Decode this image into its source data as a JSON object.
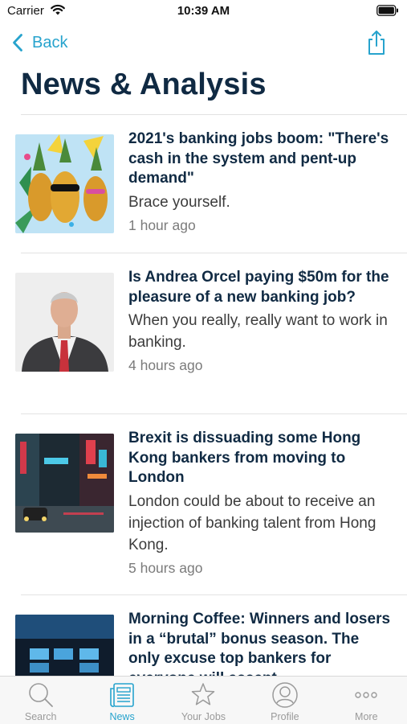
{
  "status": {
    "carrier": "Carrier",
    "time": "10:39 AM"
  },
  "nav": {
    "back_label": "Back",
    "share_icon": "share-icon"
  },
  "page": {
    "title": "News & Analysis"
  },
  "articles": [
    {
      "headline": "2021's banking jobs boom: \"There's cash in the system and pent-up demand\"",
      "summary": "Brace yourself.",
      "time": "1 hour ago",
      "image": "pineapples-party-image"
    },
    {
      "headline": "Is Andrea Orcel paying $50m for the pleasure of a new banking job?",
      "summary": "When you really, really want to work in banking.",
      "time": "4 hours ago",
      "image": "businessman-portrait-image"
    },
    {
      "headline": "Brexit is dissuading some Hong Kong bankers from moving to London",
      "summary": "London could be about to receive an injection of banking talent from Hong Kong.",
      "time": "5 hours ago",
      "image": "hong-kong-street-night-image"
    },
    {
      "headline": "Morning Coffee: Winners and losers in a “brutal” bonus season. The only excuse top bankers for everyone will accept",
      "summary": "",
      "time": "",
      "image": "trading-floor-screens-image"
    }
  ],
  "tabs": [
    {
      "label": "Search",
      "icon": "search-icon",
      "active": false
    },
    {
      "label": "News",
      "icon": "news-icon",
      "active": true
    },
    {
      "label": "Your Jobs",
      "icon": "star-icon",
      "active": false
    },
    {
      "label": "Profile",
      "icon": "profile-icon",
      "active": false
    },
    {
      "label": "More",
      "icon": "more-icon",
      "active": false
    }
  ],
  "colors": {
    "accent": "#27a3cd",
    "title": "#102a43",
    "inactive_tab": "#9a9a9a"
  }
}
